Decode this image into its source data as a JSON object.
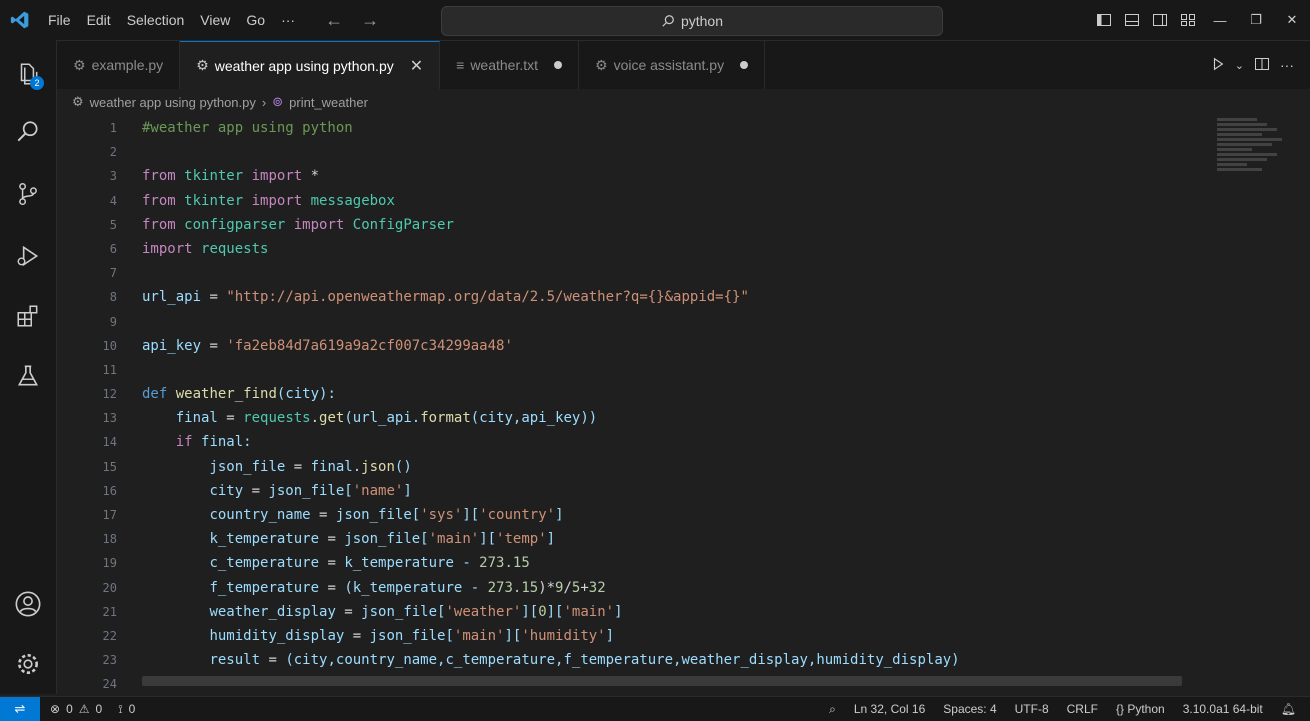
{
  "titlebar": {
    "menu": [
      "File",
      "Edit",
      "Selection",
      "View",
      "Go",
      "···"
    ],
    "search_text": "python"
  },
  "tabs": [
    {
      "label": "example.py",
      "state": "inactive",
      "icon": "settings-icon"
    },
    {
      "label": "weather app using python.py",
      "state": "active",
      "icon": "settings-icon"
    },
    {
      "label": "weather.txt",
      "state": "modified",
      "icon": "text-file-icon"
    },
    {
      "label": "voice assistant.py",
      "state": "modified",
      "icon": "settings-icon"
    }
  ],
  "breadcrumb": {
    "file": "weather app using python.py",
    "symbol": "print_weather"
  },
  "editor": {
    "line_numbers": [
      "1",
      "2",
      "3",
      "4",
      "5",
      "6",
      "7",
      "8",
      "9",
      "10",
      "11",
      "12",
      "13",
      "14",
      "15",
      "16",
      "17",
      "18",
      "19",
      "20",
      "21",
      "22",
      "23",
      "24"
    ],
    "code": {
      "l1": "#weather app using python",
      "l3a": "from",
      "l3b": "tkinter",
      "l3c": "import",
      "l3d": "*",
      "l4a": "from",
      "l4b": "tkinter",
      "l4c": "import",
      "l4d": "messagebox",
      "l5a": "from",
      "l5b": "configparser",
      "l5c": "import",
      "l5d": "ConfigParser",
      "l6a": "import",
      "l6b": "requests",
      "l8a": "url_api",
      "l8b": " = ",
      "l8c": "\"http://api.openweathermap.org/data/2.5/weather?q={}&appid={}\"",
      "l10a": "api_key",
      "l10b": " = ",
      "l10c": "'fa2eb84d7a619a9a2cf007c34299aa48'",
      "l12a": "def",
      "l12b": "weather_find",
      "l12c": "(city):",
      "l13a": "final",
      "l13b": " = ",
      "l13c": "requests",
      "l13d": ".",
      "l13e": "get",
      "l13f": "(url_api.",
      "l13g": "format",
      "l13h": "(city,api_key))",
      "l14a": "if",
      "l14b": "final:",
      "l15a": "json_file",
      "l15b": " = ",
      "l15c": "final.",
      "l15d": "json",
      "l15e": "()",
      "l16a": "city",
      "l16b": " = ",
      "l16c": "json_file[",
      "l16d": "'name'",
      "l16e": "]",
      "l17a": "country_name",
      "l17b": " = ",
      "l17c": "json_file[",
      "l17d": "'sys'",
      "l17e": "][",
      "l17f": "'country'",
      "l17g": "]",
      "l18a": "k_temperature",
      "l18b": " = ",
      "l18c": "json_file[",
      "l18d": "'main'",
      "l18e": "][",
      "l18f": "'temp'",
      "l18g": "]",
      "l19a": "c_temperature",
      "l19b": " = ",
      "l19c": "k_temperature - ",
      "l19d": "273.15",
      "l20a": "f_temperature",
      "l20b": " = ",
      "l20c": "(k_temperature - ",
      "l20d": "273.15",
      "l20e": ")*",
      "l20f": "9",
      "l20g": "/",
      "l20h": "5",
      "l20i": "+",
      "l20j": "32",
      "l21a": "weather_display",
      "l21b": " = ",
      "l21c": "json_file[",
      "l21d": "'weather'",
      "l21e": "][",
      "l21f": "0",
      "l21g": "][",
      "l21h": "'main'",
      "l21i": "]",
      "l22a": "humidity_display",
      "l22b": " = ",
      "l22c": "json_file[",
      "l22d": "'main'",
      "l22e": "][",
      "l22f": "'humidity'",
      "l22g": "]",
      "l23a": "result",
      "l23b": " = ",
      "l23c": "(city,country_name,c_temperature,f_temperature,weather_display,humidity_display)"
    }
  },
  "statusbar": {
    "errors": "0",
    "warnings": "0",
    "ports": "0",
    "position": "Ln 32, Col 16",
    "spaces": "Spaces: 4",
    "encoding": "UTF-8",
    "eol": "CRLF",
    "language": "Python",
    "interpreter": "3.10.0a1 64-bit"
  },
  "colors": {
    "accent": "#0078d4",
    "background": "#1f1f1f",
    "sidebar": "#181818"
  }
}
